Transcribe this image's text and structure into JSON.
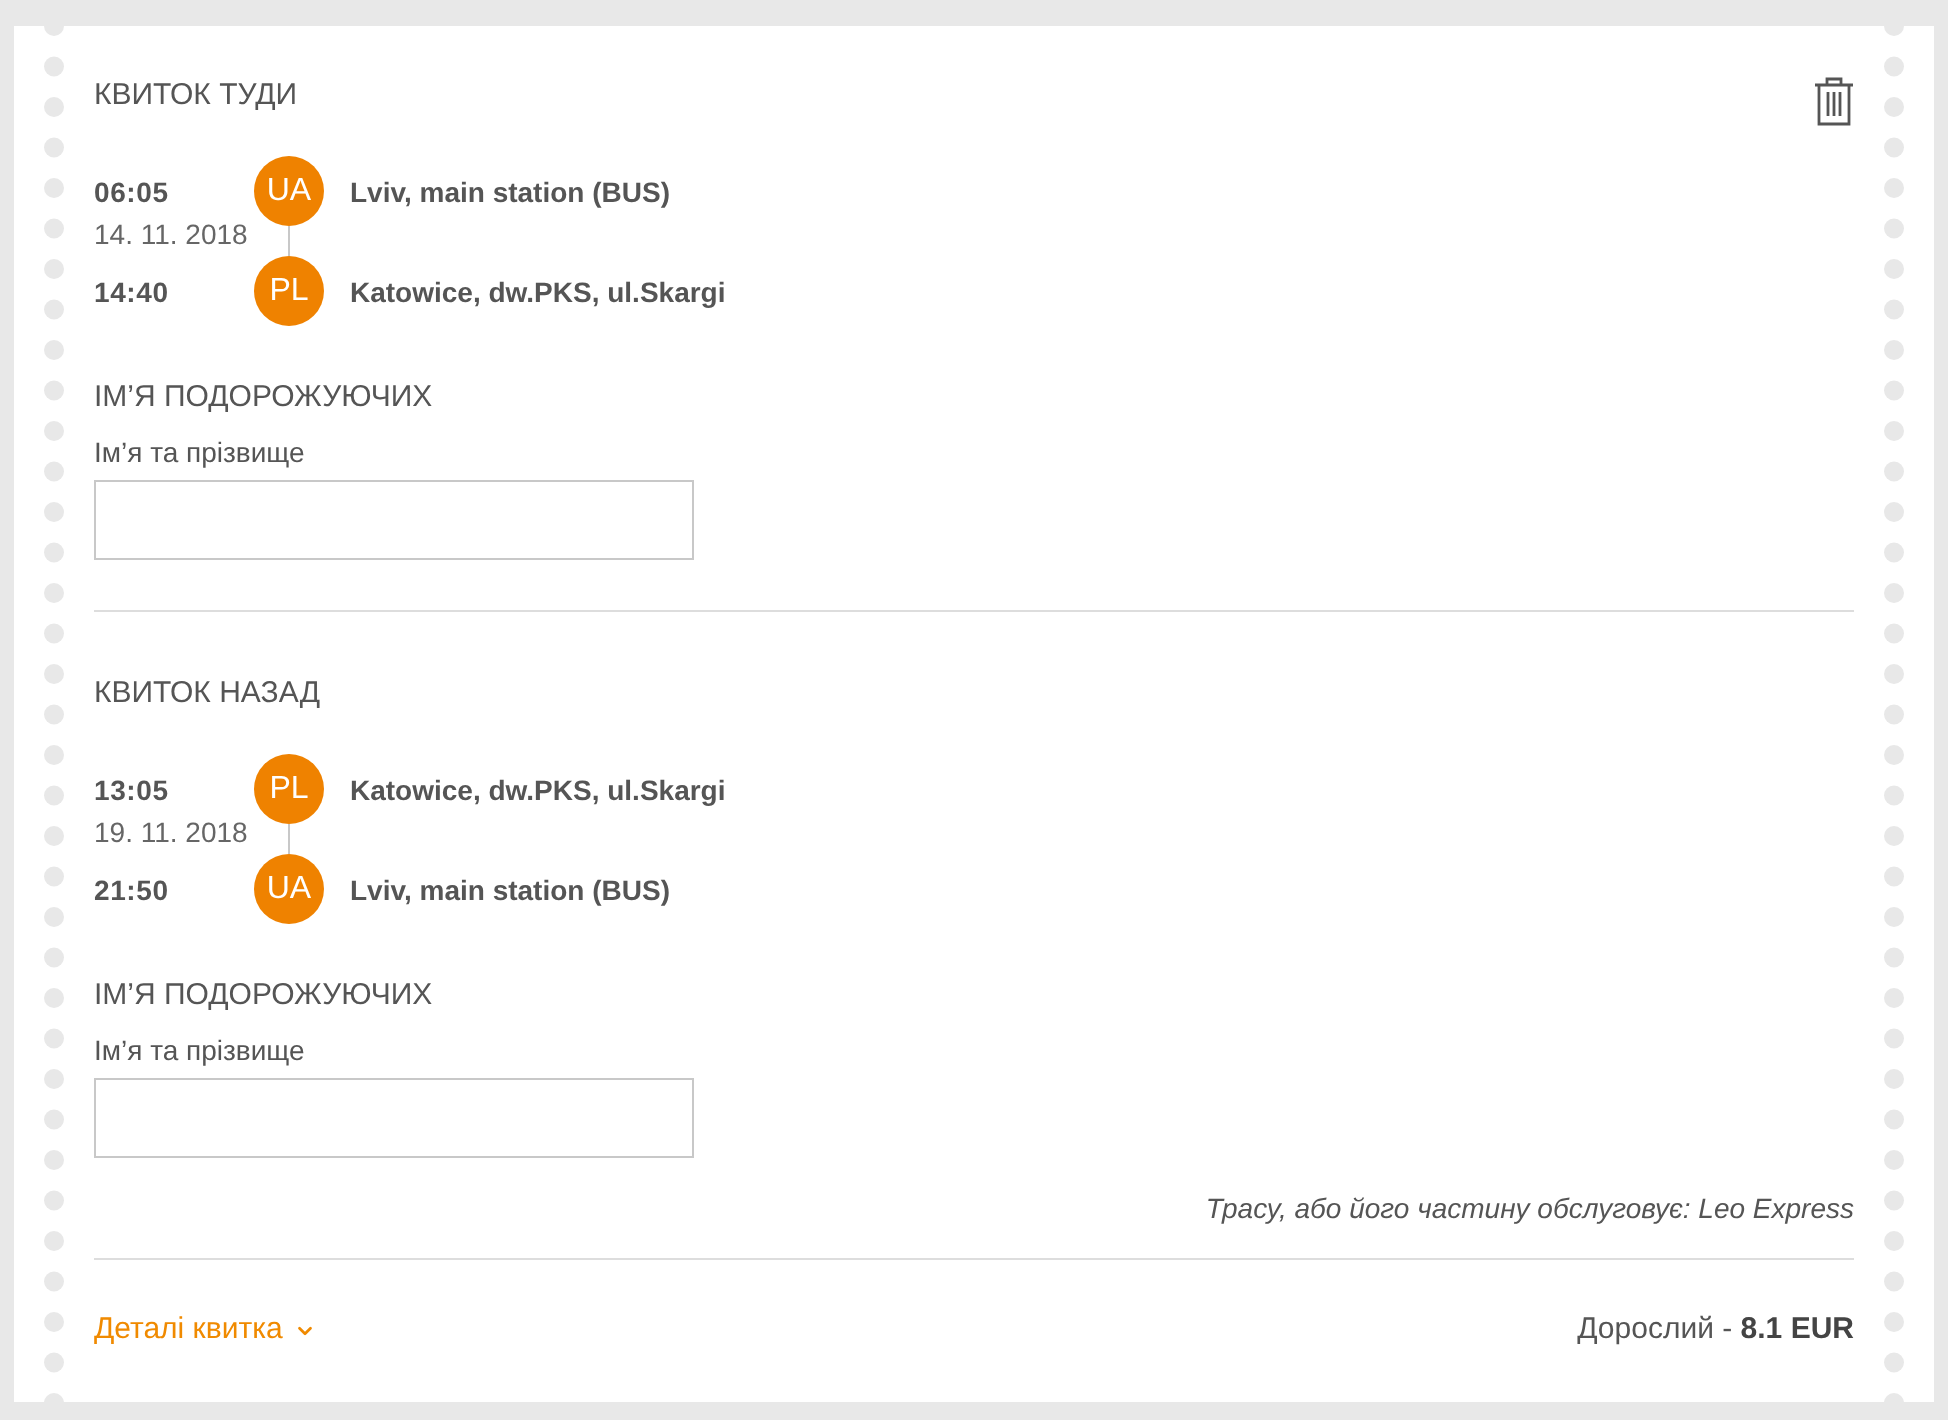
{
  "sections": [
    {
      "title": "КВИТОК ТУДИ",
      "stops": [
        {
          "time": "06:05",
          "date": "14. 11. 2018",
          "country": "UA",
          "station": "Lviv, main station (BUS)"
        },
        {
          "time": "14:40",
          "country": "PL",
          "station": "Katowice, dw.PKS, ul.Skargi"
        }
      ],
      "passengers_heading": "ІМ’Я ПОДОРОЖУЮЧИХ",
      "name_field": {
        "label": "Ім’я та прізвище"
      }
    },
    {
      "title": "КВИТОК НАЗАД",
      "stops": [
        {
          "time": "13:05",
          "date": "19. 11. 2018",
          "country": "PL",
          "station": "Katowice, dw.PKS, ul.Skargi"
        },
        {
          "time": "21:50",
          "country": "UA",
          "station": "Lviv, main station (BUS)"
        }
      ],
      "passengers_heading": "ІМ’Я ПОДОРОЖУЮЧИХ",
      "name_field": {
        "label": "Ім’я та прізвище"
      }
    }
  ],
  "operator_note": "Трасу, або його частину обслуговує: Leo Express",
  "footer": {
    "details_link": "Деталі квитка",
    "price": "Дорослий - **8.1 EUR**"
  }
}
